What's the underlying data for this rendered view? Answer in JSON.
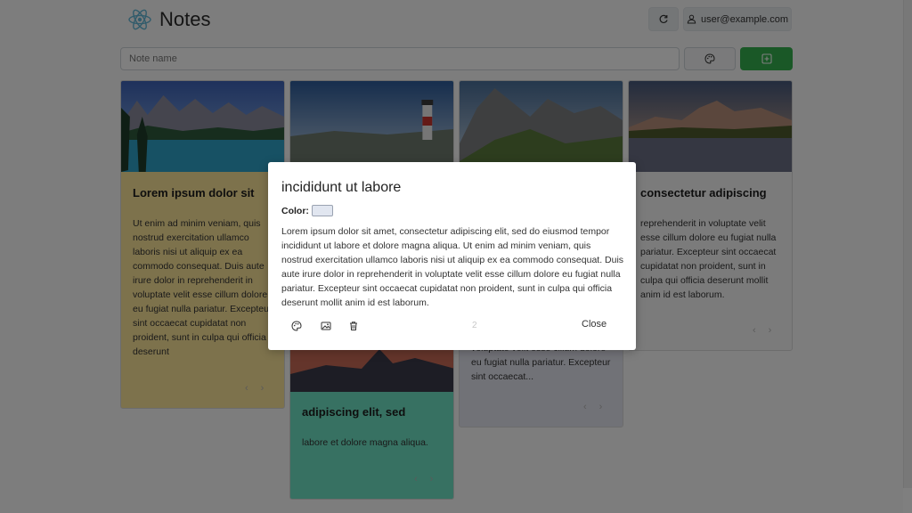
{
  "app": {
    "title": "Notes",
    "user": "user@example.com",
    "icons": {
      "logo": "react-atom-icon",
      "refresh": "refresh-icon",
      "user": "user-icon",
      "palette": "palette-icon",
      "add": "plus-square-icon"
    }
  },
  "toolbar": {
    "note_placeholder": "Note name"
  },
  "cards": [
    {
      "title": "Lorem ipsum dolor sit",
      "body": "Ut enim ad minim veniam, quis nostrud exercitation ullamco laboris nisi ut aliquip ex ea commodo consequat. Duis aute irure dolor in reprehenderit in voluptate velit esse cillum dolore eu fugiat nulla pariatur. Excepteur sint occaecat cupidatat non proident, sunt in culpa qui officia deserunt",
      "color": "#fbe499",
      "image": "lake-mountains-photo"
    },
    {
      "title": "adipiscing elit, sed",
      "body": "labore et dolore magna aliqua.",
      "color": "#6fe3c4",
      "image": "lighthouse-photo"
    },
    {
      "title": "",
      "body": "voluptate velit esse cillum dolore eu fugiat nulla pariatur. Excepteur sint occaecat...",
      "color": "#e3e4ee",
      "image": "mountain-ridge-photo"
    },
    {
      "title": "consectetur adipiscing",
      "body": "reprehenderit in voluptate velit esse cillum dolore eu fugiat nulla pariatur. Excepteur sint occaecat cupidatat non proident, sunt in culpa qui officia deserunt mollit anim id est laborum.",
      "color": "#f7f7f7",
      "image": "alpine-lake-photo"
    }
  ],
  "nav": {
    "prev": "‹",
    "next": "›"
  },
  "modal": {
    "title": "incididunt ut labore",
    "color_label": "Color:",
    "color_value": "#e1e6f0",
    "body": "Lorem ipsum dolor sit amet, consectetur adipiscing elit, sed do eiusmod tempor incididunt ut labore et dolore magna aliqua. Ut enim ad minim veniam, quis nostrud exercitation ullamco laboris nisi ut aliquip ex ea commodo consequat. Duis aute irure dolor in reprehenderit in voluptate velit esse cillum dolore eu fugiat nulla pariatur. Excepteur sint occaecat cupidatat non proident, sunt in culpa qui officia deserunt mollit anim id est laborum.",
    "page": "2",
    "close_label": "Close",
    "icons": {
      "palette": "palette-icon",
      "image": "image-icon",
      "delete": "trash-icon"
    }
  }
}
